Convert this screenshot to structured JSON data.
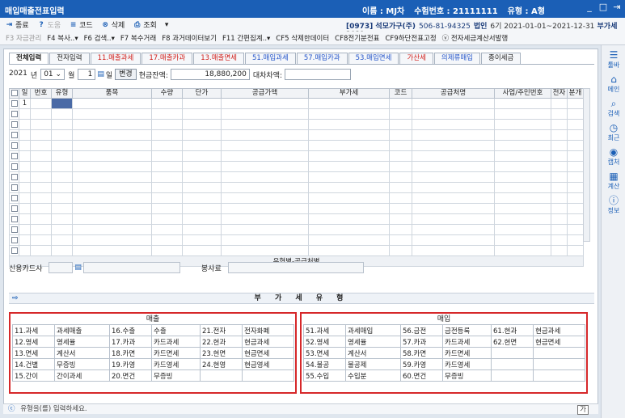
{
  "window": {
    "title": "매입매출전표입력",
    "name_label": "이름 : MJ차",
    "id_label": "수험번호 : 21111111",
    "type_label": "유형 : A형"
  },
  "toolbar": {
    "items": [
      {
        "icon": "⇥",
        "label": "종료",
        "disabled": false
      },
      {
        "icon": "?",
        "label": "도움",
        "disabled": true
      },
      {
        "icon": "≡",
        "label": "코드",
        "disabled": false
      },
      {
        "icon": "⊗",
        "label": "삭제",
        "disabled": false
      },
      {
        "icon": "⎙",
        "label": "조회",
        "disabled": false
      },
      {
        "icon": "",
        "label": "▾",
        "disabled": false
      }
    ],
    "company_code": "[0973] 석모가구(주)",
    "company_reg": "506-81-94325",
    "company_type": "법인",
    "company_period": "6기 2021-01-01~2021-12-31",
    "vat_label": "부가세",
    "year": "2021"
  },
  "fkeys": [
    {
      "label": "F3 자금관리",
      "dis": true
    },
    {
      "label": "F4 복사..▾"
    },
    {
      "label": "F6 검색..▾"
    },
    {
      "label": "F7 복수거래"
    },
    {
      "label": "F8 과거데이터보기"
    },
    {
      "label": "F11 간편집계..▾"
    },
    {
      "label": "CF5 삭제한데이터"
    },
    {
      "label": "CF8전기분전표"
    },
    {
      "label": "CF9하단전표고정"
    },
    {
      "label": "ⓥ 전자세금계산서발행"
    }
  ],
  "sidebar": [
    {
      "icon": "☰",
      "label": "툴바"
    },
    {
      "icon": "⌂",
      "label": "메인"
    },
    {
      "icon": "⌕",
      "label": "검색"
    },
    {
      "icon": "◷",
      "label": "최근"
    },
    {
      "icon": "◉",
      "label": "캡처"
    },
    {
      "icon": "▦",
      "label": "계산"
    },
    {
      "icon": "ⓘ",
      "label": "정보"
    }
  ],
  "tabs": [
    {
      "label": "전체입력",
      "style": "active"
    },
    {
      "label": "전자입력",
      "style": ""
    },
    {
      "label": "11.매출과세",
      "style": "red"
    },
    {
      "label": "17.매출카과",
      "style": "red"
    },
    {
      "label": "13.매출면세",
      "style": "red"
    },
    {
      "label": "51.매입과세",
      "style": "blue"
    },
    {
      "label": "57.매입카과",
      "style": "blue"
    },
    {
      "label": "53.매입면세",
      "style": "blue"
    },
    {
      "label": "가산세",
      "style": "red"
    },
    {
      "label": "의제류매입",
      "style": "blue"
    },
    {
      "label": "종이세금",
      "style": ""
    }
  ],
  "daterow": {
    "year": "2021",
    "year_label": "년",
    "month": "01",
    "month_label": "월",
    "day": "1",
    "day_label": "일",
    "change_btn": "변경",
    "cash_label": "현금잔액:",
    "cash_value": "18,880,200",
    "debit_label": "대차차액:"
  },
  "grid": {
    "headers": [
      "",
      "일",
      "번호",
      "유형",
      "품목",
      "수량",
      "단가",
      "공급가액",
      "부가세",
      "코드",
      "공급처명",
      "사업/주민번호",
      "전자",
      "분개"
    ],
    "first_day": "1",
    "footer": "유형별-공급처별"
  },
  "card": {
    "label": "신용카드사",
    "service_label": "봉사료"
  },
  "vat_section": {
    "title": "부 가 세 유 형",
    "sales": {
      "title": "매출",
      "rows": [
        [
          "11.과세",
          "과세매출",
          "16.수출",
          "수출",
          "21.전자",
          "전자화폐"
        ],
        [
          "12.영세",
          "영세율",
          "17.카과",
          "카드과세",
          "22.현과",
          "현금과세"
        ],
        [
          "13.면세",
          "계산서",
          "18.카면",
          "카드면세",
          "23.현면",
          "현금면세"
        ],
        [
          "14.건별",
          "무증빙",
          "19.카영",
          "카드영세",
          "24.현영",
          "현금영세"
        ],
        [
          "15.간이",
          "간이과세",
          "20.면건",
          "무증빙",
          "",
          ""
        ]
      ]
    },
    "purchase": {
      "title": "매입",
      "rows": [
        [
          "51.과세",
          "과세매입",
          "56.금전",
          "금전등록",
          "61.현과",
          "현금과세"
        ],
        [
          "52.영세",
          "영세율",
          "57.카과",
          "카드과세",
          "62.현면",
          "현금면세"
        ],
        [
          "53.면세",
          "계산서",
          "58.카면",
          "카드면세",
          "",
          ""
        ],
        [
          "54.불공",
          "불공제",
          "59.카영",
          "카드영세",
          "",
          ""
        ],
        [
          "55.수입",
          "수입분",
          "60.면건",
          "무증빙",
          "",
          ""
        ]
      ]
    }
  },
  "status": {
    "message": "유형을(를) 입력하세요.",
    "lang": "가"
  }
}
